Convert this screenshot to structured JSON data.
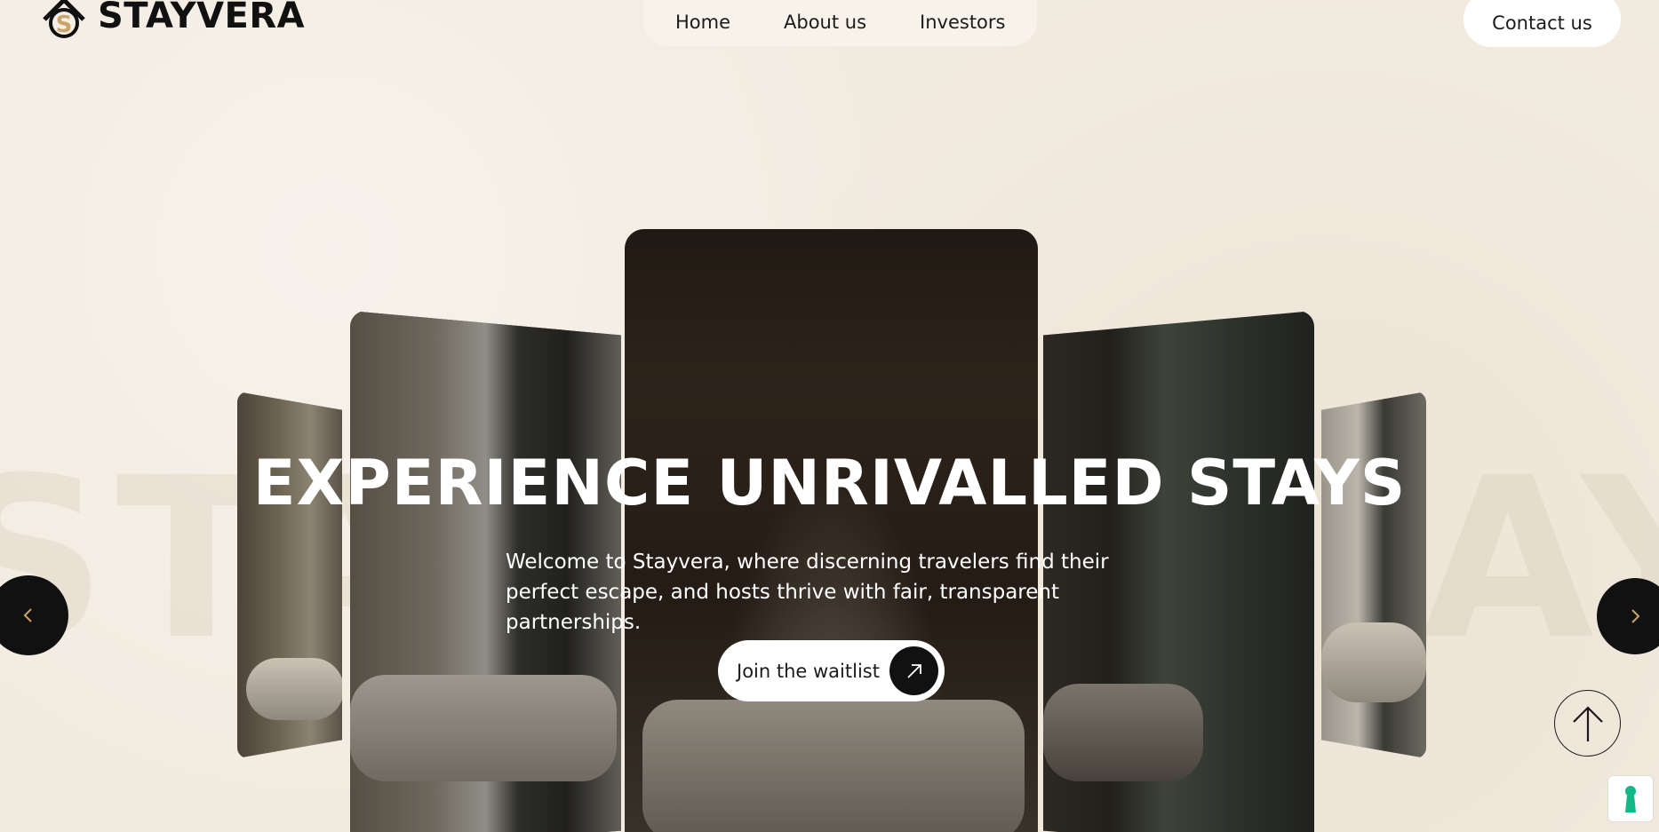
{
  "brand": {
    "name": "STAYVERA",
    "logo_icon": "stayvera-logo-icon",
    "accent": "#c9a46b"
  },
  "nav": {
    "items": [
      {
        "label": "Home"
      },
      {
        "label": "About us"
      },
      {
        "label": "Investors"
      }
    ]
  },
  "header": {
    "contact_label": "Contact us"
  },
  "hero": {
    "watermark_left": "STA",
    "watermark_right": "AY",
    "headline": "EXPERIENCE UNRIVALLED STAYS",
    "subtitle": "Welcome to Stayvera, where discerning travelers find their perfect escape, and hosts thrive with fair, transparent partnerships.",
    "cta_label": "Join the waitlist",
    "cta_icon": "arrow-up-right-icon"
  },
  "controls": {
    "prev_icon": "chevron-left-icon",
    "next_icon": "chevron-right-icon",
    "scroll_top_icon": "arrow-up-icon",
    "widget_icon": "accessibility-keyhole-icon"
  },
  "colors": {
    "background": "#f2ebe0",
    "dark": "#111111",
    "accent_green": "#12b886"
  }
}
